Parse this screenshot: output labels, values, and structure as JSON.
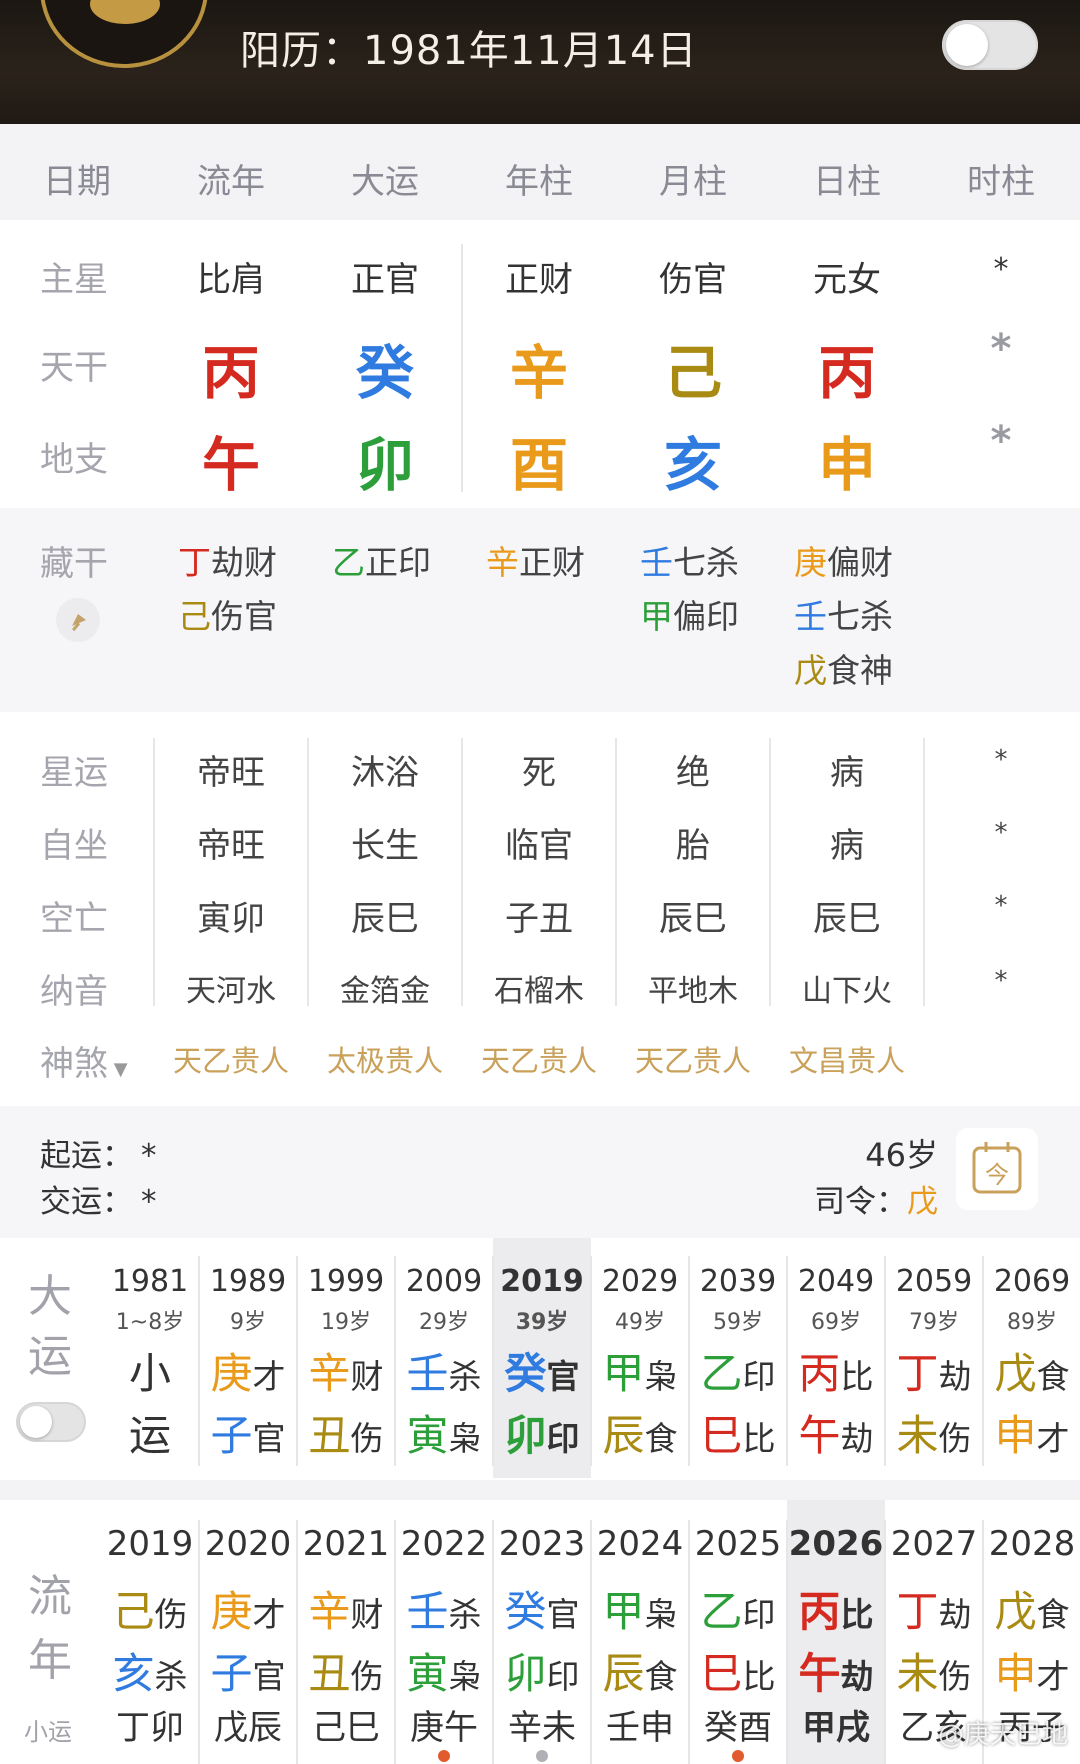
{
  "header": {
    "solar_date": "阳历：1981年11月14日"
  },
  "tabs": [
    "日期",
    "流年",
    "大运",
    "年柱",
    "月柱",
    "日柱",
    "时柱"
  ],
  "colors": {
    "fire": "#d42a1f",
    "water": "#2f7be0",
    "metal": "#e99a1b",
    "earth": "#a98a12",
    "wood": "#2d9f3a",
    "muted": "#a5a5ad",
    "shensha": "#c9a15a"
  },
  "pillars": {
    "labels": {
      "main_star": "主星",
      "heavenly_stem": "天干",
      "earthly_branch": "地支",
      "hidden_stem": "藏干"
    },
    "main_star": [
      "比肩",
      "正官",
      "正财",
      "伤官",
      "元女",
      "*"
    ],
    "stems": [
      {
        "char": "丙",
        "color": "#d42a1f"
      },
      {
        "char": "癸",
        "color": "#2f7be0"
      },
      {
        "char": "辛",
        "color": "#e99a1b"
      },
      {
        "char": "己",
        "color": "#a98a12"
      },
      {
        "char": "丙",
        "color": "#d42a1f"
      },
      {
        "char": "*",
        "color": "#9a9aa2"
      }
    ],
    "branches": [
      {
        "char": "午",
        "color": "#d42a1f"
      },
      {
        "char": "卯",
        "color": "#2d9f3a"
      },
      {
        "char": "酉",
        "color": "#e99a1b"
      },
      {
        "char": "亥",
        "color": "#2f7be0"
      },
      {
        "char": "申",
        "color": "#e99a1b"
      },
      {
        "char": "*",
        "color": "#9a9aa2"
      }
    ],
    "hidden": [
      [
        {
          "stem": "丁",
          "god": "劫财",
          "color": "#d42a1f"
        },
        {
          "stem": "己",
          "god": "伤官",
          "color": "#a98a12"
        }
      ],
      [
        {
          "stem": "乙",
          "god": "正印",
          "color": "#2d9f3a"
        }
      ],
      [
        {
          "stem": "辛",
          "god": "正财",
          "color": "#e99a1b"
        }
      ],
      [
        {
          "stem": "壬",
          "god": "七杀",
          "color": "#2f7be0"
        },
        {
          "stem": "甲",
          "god": "偏印",
          "color": "#2d9f3a"
        }
      ],
      [
        {
          "stem": "庚",
          "god": "偏财",
          "color": "#e99a1b"
        },
        {
          "stem": "壬",
          "god": "七杀",
          "color": "#2f7be0"
        },
        {
          "stem": "戊",
          "god": "食神",
          "color": "#a98a12"
        }
      ]
    ]
  },
  "info_rows": {
    "labels": [
      "星运",
      "自坐",
      "空亡",
      "纳音"
    ],
    "star_luck": [
      "帝旺",
      "沐浴",
      "死",
      "绝",
      "病",
      "*"
    ],
    "self_seat": [
      "帝旺",
      "长生",
      "临官",
      "胎",
      "病",
      "*"
    ],
    "void": [
      "寅卯",
      "辰巳",
      "子丑",
      "辰巳",
      "辰巳",
      "*"
    ],
    "nayin": [
      "天河水",
      "金箔金",
      "石榴木",
      "平地木",
      "山下火",
      "*"
    ]
  },
  "shensha": {
    "label": "神煞",
    "items": [
      "天乙贵人",
      "太极贵人",
      "天乙贵人",
      "天乙贵人",
      "文昌贵人"
    ]
  },
  "luck_info": {
    "start_label": "起运：",
    "start_value": "*",
    "change_label": "交运：",
    "change_value": "*",
    "age": "46岁",
    "commander_label": "司令：",
    "commander_value": "戊",
    "calendar_icon_text": "今"
  },
  "dayun": {
    "label_top": "大",
    "label_bottom": "运",
    "columns": [
      {
        "year": "1981",
        "age": "1~8岁",
        "top": "小",
        "top_god": "",
        "top_color": "#333333",
        "bot": "运",
        "bot_god": "",
        "bot_color": "#333333"
      },
      {
        "year": "1989",
        "age": "9岁",
        "top": "庚",
        "top_god": "才",
        "top_color": "#e99a1b",
        "bot": "子",
        "bot_god": "官",
        "bot_color": "#2f7be0"
      },
      {
        "year": "1999",
        "age": "19岁",
        "top": "辛",
        "top_god": "财",
        "top_color": "#e99a1b",
        "bot": "丑",
        "bot_god": "伤",
        "bot_color": "#a98a12"
      },
      {
        "year": "2009",
        "age": "29岁",
        "top": "壬",
        "top_god": "杀",
        "top_color": "#2f7be0",
        "bot": "寅",
        "bot_god": "枭",
        "bot_color": "#2d9f3a"
      },
      {
        "year": "2019",
        "age": "39岁",
        "top": "癸",
        "top_god": "官",
        "top_color": "#2f7be0",
        "bot": "卯",
        "bot_god": "印",
        "bot_color": "#2d9f3a"
      },
      {
        "year": "2029",
        "age": "49岁",
        "top": "甲",
        "top_god": "枭",
        "top_color": "#2d9f3a",
        "bot": "辰",
        "bot_god": "食",
        "bot_color": "#a98a12"
      },
      {
        "year": "2039",
        "age": "59岁",
        "top": "乙",
        "top_god": "印",
        "top_color": "#2d9f3a",
        "bot": "巳",
        "bot_god": "比",
        "bot_color": "#d42a1f"
      },
      {
        "year": "2049",
        "age": "69岁",
        "top": "丙",
        "top_god": "比",
        "top_color": "#d42a1f",
        "bot": "午",
        "bot_god": "劫",
        "bot_color": "#d42a1f"
      },
      {
        "year": "2059",
        "age": "79岁",
        "top": "丁",
        "top_god": "劫",
        "top_color": "#d42a1f",
        "bot": "未",
        "bot_god": "伤",
        "bot_color": "#a98a12"
      },
      {
        "year": "2069",
        "age": "89岁",
        "top": "戊",
        "top_god": "食",
        "top_color": "#a98a12",
        "bot": "申",
        "bot_god": "才",
        "bot_color": "#e99a1b"
      }
    ]
  },
  "liunian": {
    "label_top": "流",
    "label_bottom": "年",
    "label_small": "小运",
    "columns": [
      {
        "year": "2019",
        "top": "己",
        "top_god": "伤",
        "top_color": "#a98a12",
        "bot": "亥",
        "bot_god": "杀",
        "bot_color": "#2f7be0",
        "xiao": "丁卯"
      },
      {
        "year": "2020",
        "top": "庚",
        "top_god": "才",
        "top_color": "#e99a1b",
        "bot": "子",
        "bot_god": "官",
        "bot_color": "#2f7be0",
        "xiao": "戊辰"
      },
      {
        "year": "2021",
        "top": "辛",
        "top_god": "财",
        "top_color": "#e99a1b",
        "bot": "丑",
        "bot_god": "伤",
        "bot_color": "#a98a12",
        "xiao": "己巳"
      },
      {
        "year": "2022",
        "top": "壬",
        "top_god": "杀",
        "top_color": "#2f7be0",
        "bot": "寅",
        "bot_god": "枭",
        "bot_color": "#2d9f3a",
        "xiao": "庚午"
      },
      {
        "year": "2023",
        "top": "癸",
        "top_god": "官",
        "top_color": "#2f7be0",
        "bot": "卯",
        "bot_god": "印",
        "bot_color": "#2d9f3a",
        "xiao": "辛未"
      },
      {
        "year": "2024",
        "top": "甲",
        "top_god": "枭",
        "top_color": "#2d9f3a",
        "bot": "辰",
        "bot_god": "食",
        "bot_color": "#a98a12",
        "xiao": "壬申"
      },
      {
        "year": "2025",
        "top": "乙",
        "top_god": "印",
        "top_color": "#2d9f3a",
        "bot": "巳",
        "bot_god": "比",
        "bot_color": "#d42a1f",
        "xiao": "癸酉"
      },
      {
        "year": "2026",
        "top": "丙",
        "top_god": "比",
        "top_color": "#d42a1f",
        "bot": "午",
        "bot_god": "劫",
        "bot_color": "#d42a1f",
        "xiao": "甲戌"
      },
      {
        "year": "2027",
        "top": "丁",
        "top_god": "劫",
        "top_color": "#d42a1f",
        "bot": "未",
        "bot_god": "伤",
        "bot_color": "#a98a12",
        "xiao": "乙亥"
      },
      {
        "year": "2028",
        "top": "戊",
        "top_god": "食",
        "top_color": "#a98a12",
        "bot": "申",
        "bot_god": "才",
        "bot_color": "#e99a1b",
        "xiao": "丙子"
      }
    ]
  },
  "watermark": "@庚天巳地"
}
